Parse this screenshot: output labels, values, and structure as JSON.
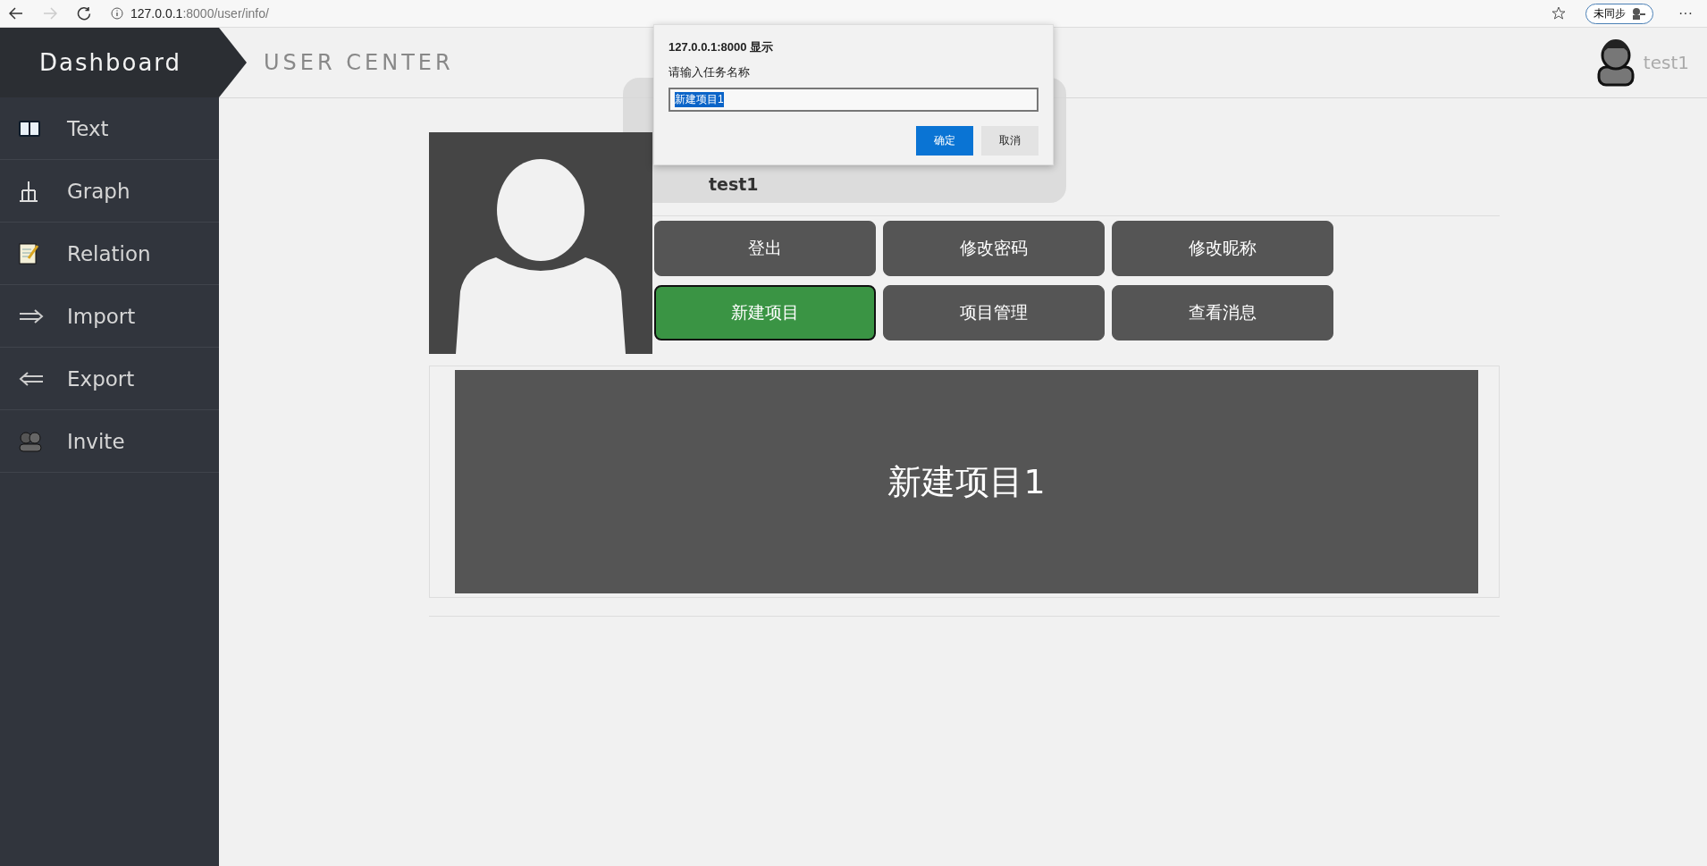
{
  "browser": {
    "back_enabled": true,
    "forward_enabled": false,
    "url_host": "127.0.0.1",
    "url_rest": ":8000/user/info/",
    "sync_label": "未同步",
    "menu": "···"
  },
  "sidebar": {
    "title": "Dashboard",
    "items": [
      {
        "label": "Text"
      },
      {
        "label": "Graph"
      },
      {
        "label": "Relation"
      },
      {
        "label": "Import"
      },
      {
        "label": "Export"
      },
      {
        "label": "Invite"
      }
    ]
  },
  "header": {
    "title": "USER CENTER",
    "user": "test1"
  },
  "profile": {
    "name": "test1",
    "buttons": [
      {
        "label": "登出",
        "selected": false
      },
      {
        "label": "修改密码",
        "selected": false
      },
      {
        "label": "修改昵称",
        "selected": false
      },
      {
        "label": "新建项目",
        "selected": true
      },
      {
        "label": "项目管理",
        "selected": false
      },
      {
        "label": "查看消息",
        "selected": false
      }
    ]
  },
  "projects": [
    {
      "name": "新建项目1"
    }
  ],
  "dialog": {
    "title": "127.0.0.1:8000 显示",
    "message": "请输入任务名称",
    "value": "新建项目1",
    "text_selected": true,
    "buttons": [
      {
        "label": "确定",
        "primary": true
      },
      {
        "label": "取消",
        "primary": false
      }
    ]
  }
}
